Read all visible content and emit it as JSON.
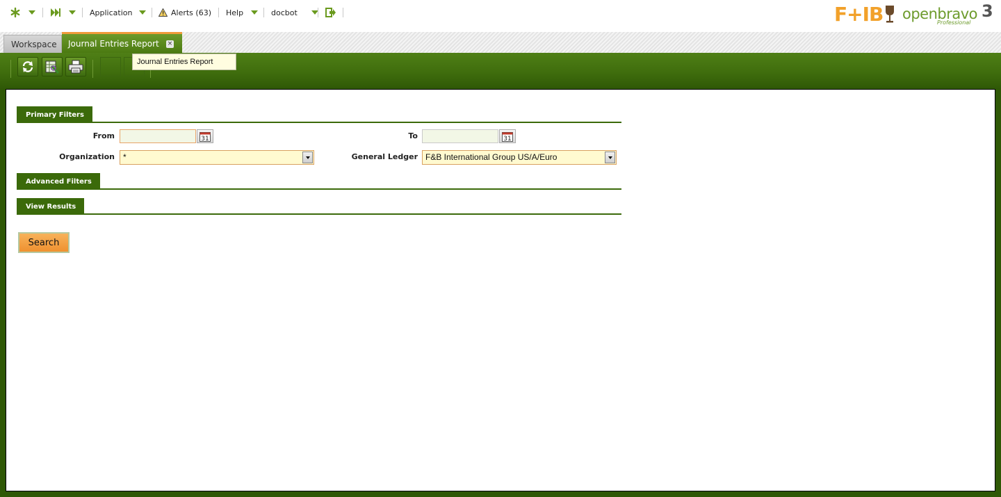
{
  "nav": {
    "application": "Application",
    "alerts": "Alerts (63)",
    "help": "Help",
    "user": "docbot"
  },
  "logos": {
    "fb_text": "F+IB",
    "openbravo_text": "openbravo",
    "openbravo_edition": "Professional",
    "openbravo_version": "3"
  },
  "tabs": {
    "workspace": "Workspace",
    "active": "Journal Entries Report",
    "close": "×"
  },
  "tooltip": "Journal Entries Report",
  "sections": {
    "primary": "Primary Filters",
    "advanced": "Advanced Filters",
    "results": "View Results"
  },
  "form": {
    "from_label": "From",
    "to_label": "To",
    "from_value": "",
    "to_value": "",
    "calendar_day": "31",
    "organization_label": "Organization",
    "organization_value": "*",
    "general_ledger_label": "General Ledger",
    "general_ledger_value": "F&B International Group US/A/Euro"
  },
  "actions": {
    "search": "Search"
  },
  "colors": {
    "brand_green": "#3b6a0a",
    "accent_orange": "#f09a3a",
    "fb_orange": "#f2a12a",
    "fb_brown": "#6b4a2a"
  }
}
